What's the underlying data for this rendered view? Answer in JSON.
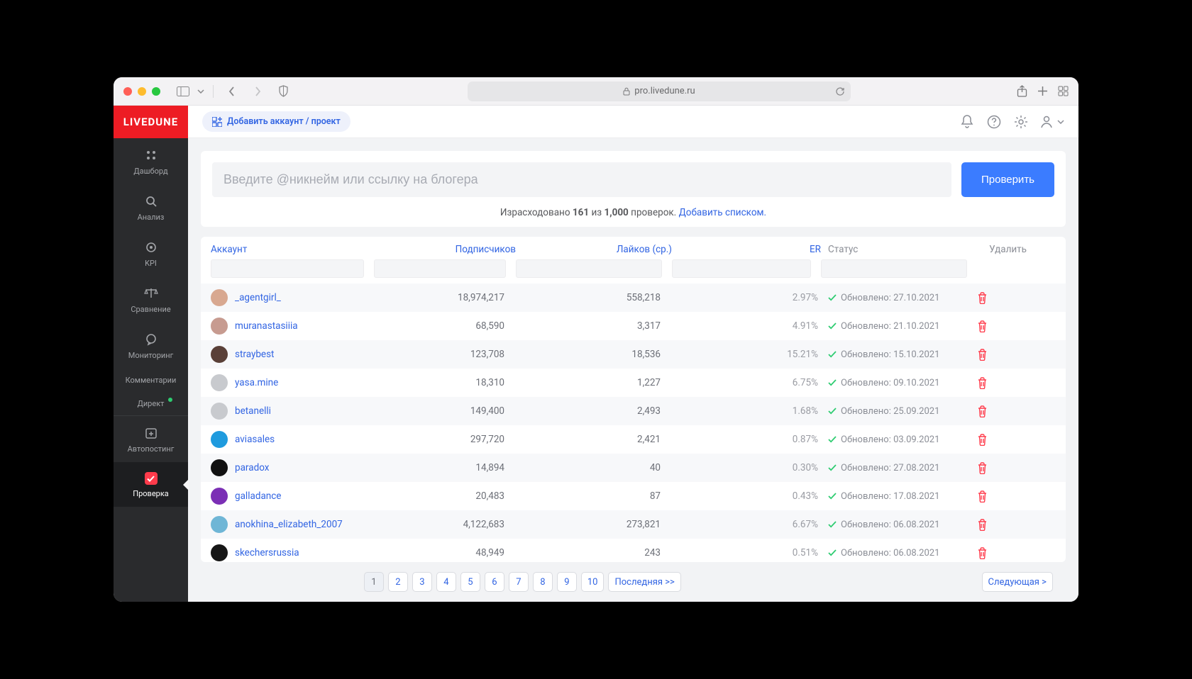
{
  "browser": {
    "url_host": "pro.livedune.ru"
  },
  "app": {
    "brand": "LIVEDUNE",
    "add_account_label": "Добавить аккаунт / проект"
  },
  "sidebar": {
    "items": [
      {
        "label": "Дашборд"
      },
      {
        "label": "Анализ"
      },
      {
        "label": "KPI"
      },
      {
        "label": "Сравнение"
      },
      {
        "label": "Мониторинг"
      },
      {
        "label": "Комментарии"
      },
      {
        "label": "Директ"
      },
      {
        "label": "Автопостинг"
      },
      {
        "label": "Проверка"
      }
    ]
  },
  "search": {
    "placeholder": "Введите @никнейм или ссылку на блогера",
    "button": "Проверить",
    "quota_prefix": "Израсходовано ",
    "quota_used": "161",
    "quota_of": " из ",
    "quota_total": "1,000",
    "quota_suffix": " проверок. ",
    "add_list_link": "Добавить списком."
  },
  "table": {
    "headers": {
      "account": "Аккаунт",
      "followers": "Подписчиков",
      "likes": "Лайков (ср.)",
      "er": "ER",
      "status": "Статус",
      "delete": "Удалить"
    },
    "status_prefix": "Обновлено: ",
    "rows": [
      {
        "username": "_agentgirl_",
        "followers": "18,974,217",
        "likes": "558,218",
        "er": "2.97%",
        "updated": "27.10.2021",
        "avatar": "#d8a890"
      },
      {
        "username": "muranastasiiia",
        "followers": "68,590",
        "likes": "3,317",
        "er": "4.91%",
        "updated": "21.10.2021",
        "avatar": "#c79b90"
      },
      {
        "username": "straybest",
        "followers": "123,708",
        "likes": "18,536",
        "er": "15.21%",
        "updated": "15.10.2021",
        "avatar": "#5a4038"
      },
      {
        "username": "yasa.mine",
        "followers": "18,310",
        "likes": "1,227",
        "er": "6.75%",
        "updated": "09.10.2021",
        "avatar": "#c8cace"
      },
      {
        "username": "betanelli",
        "followers": "149,400",
        "likes": "2,493",
        "er": "1.68%",
        "updated": "25.09.2021",
        "avatar": "#c8cace"
      },
      {
        "username": "aviasales",
        "followers": "297,720",
        "likes": "2,421",
        "er": "0.87%",
        "updated": "03.09.2021",
        "avatar": "#1f9bde"
      },
      {
        "username": "paradox",
        "followers": "14,894",
        "likes": "40",
        "er": "0.30%",
        "updated": "27.08.2021",
        "avatar": "#111111"
      },
      {
        "username": "galladance",
        "followers": "20,483",
        "likes": "87",
        "er": "0.43%",
        "updated": "17.08.2021",
        "avatar": "#7b2fb5"
      },
      {
        "username": "anokhina_elizabeth_2007",
        "followers": "4,122,683",
        "likes": "273,821",
        "er": "6.67%",
        "updated": "06.08.2021",
        "avatar": "#6fb6d6"
      },
      {
        "username": "skechersrussia",
        "followers": "48,949",
        "likes": "243",
        "er": "0.51%",
        "updated": "06.08.2021",
        "avatar": "#161616"
      }
    ]
  },
  "pagination": {
    "pages": [
      "1",
      "2",
      "3",
      "4",
      "5",
      "6",
      "7",
      "8",
      "9",
      "10"
    ],
    "active": "1",
    "last": "Последняя >>",
    "next": "Следующая >"
  }
}
